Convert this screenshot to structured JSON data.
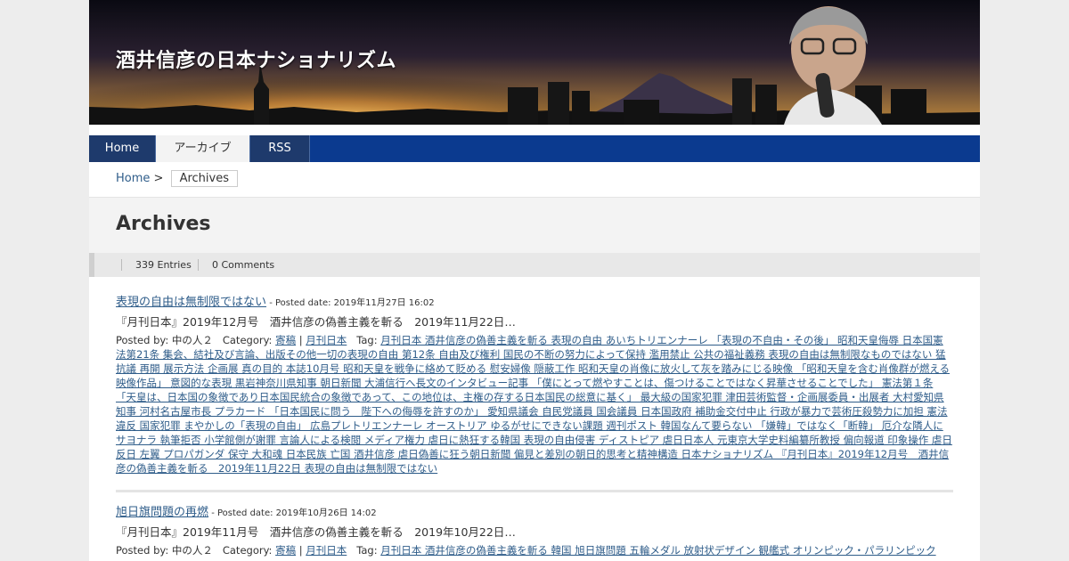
{
  "site": {
    "title": "酒井信彦の日本ナショナリズム"
  },
  "nav": {
    "items": [
      "Home",
      "アーカイブ",
      "RSS"
    ],
    "active_index": 1
  },
  "breadcrumb": {
    "home": "Home",
    "separator": ">",
    "current": "Archives"
  },
  "page": {
    "title": "Archives",
    "entries_count": "339 Entries",
    "comments_count": "0 Comments"
  },
  "posts": [
    {
      "title": "表現の自由は無制限ではない",
      "date": " - Posted date: 2019年11月27日 16:02",
      "excerpt": "『月刊日本』2019年12月号　酒井信彦の偽善主義を斬る　2019年11月22日…",
      "posted_by": "Posted by: 中の人２",
      "category_label": "Category:",
      "categories": [
        "寄稿",
        "月刊日本"
      ],
      "tag_label": "Tag:",
      "tags": "月刊日本 酒井信彦の偽善主義を斬る 表現の自由 あいちトリエンナーレ 「表現の不自由・その後」 昭和天皇侮辱 日本国憲法第21条 集会、結社及び言論、出版その他一切の表現の自由 第12条 自由及び権利 国民の不断の努力によって保持 濫用禁止 公共の福祉義務 表現の自由は無制限なものではない 猛抗議 再開 展示方法 企画展 真の目的 本誌10月号 昭和天皇を戦争に絡めて貶める 慰安婦像 隠蔽工作 昭和天皇の肖像に放火して灰を踏みにじる映像 「昭和天皇を含む肖像群が燃える映像作品」 意図的な表現 黒岩神奈川県知事 朝日新聞 大浦信行へ長文のインタビュー記事 「僕にとって燃やすことは、傷つけることではなく昇華させることでした」 憲法第１条 「天皇は、日本国の象徴であり日本国民統合の象徴であって、この地位は、主権の存する日本国民の総意に基く」 最大級の国家犯罪 津田芸術監督・企画展委員・出展者 大村愛知県知事 河村名古屋市長 プラカード 「日本国民に問う　陛下への侮辱を許すのか」 愛知県議会 自民党議員 国会議員 日本国政府 補助金交付中止 行政が暴力で芸術圧殺勢力に加担 憲法違反 国家犯罪 まやかしの「表現の自由」 広島プレトリエンナーレ オーストリア ゆるがせにできない課題 週刊ポスト 韓国なんて要らない 「嫌韓」ではなく「断韓」 厄介な隣人にサヨナラ 執筆拒否 小学館側が謝罪 言論人による検閲 メディア権力 虐日に熱狂する韓国 表現の自由侵害 ディストピア 虐日日本人 元東京大学史料編纂所教授 偏向報道 印象操作 虐日 反日 左翼 プロパガンダ 保守 大和魂 日本民族 亡国 酒井信彦 虐日偽善に狂う朝日新聞 偏見と差別の朝日的思考と精神構造 日本ナショナリズム 『月刊日本』2019年12月号　酒井信彦の偽善主義を斬る　2019年11月22日 表現の自由は無制限ではない"
    },
    {
      "title": "旭日旗問題の再燃",
      "date": " - Posted date: 2019年10月26日 14:02",
      "excerpt": "『月刊日本』2019年11月号　酒井信彦の偽善主義を斬る　2019年10月22日…",
      "posted_by": "Posted by: 中の人２",
      "category_label": "Category:",
      "categories": [
        "寄稿",
        "月刊日本"
      ],
      "tag_label": "Tag:",
      "tags": "月刊日本 酒井信彦の偽善主義を斬る 韓国 旭日旗問題 五輪メダル 放射状デザイン 観艦式 オリンピック・パラリンピック"
    }
  ]
}
